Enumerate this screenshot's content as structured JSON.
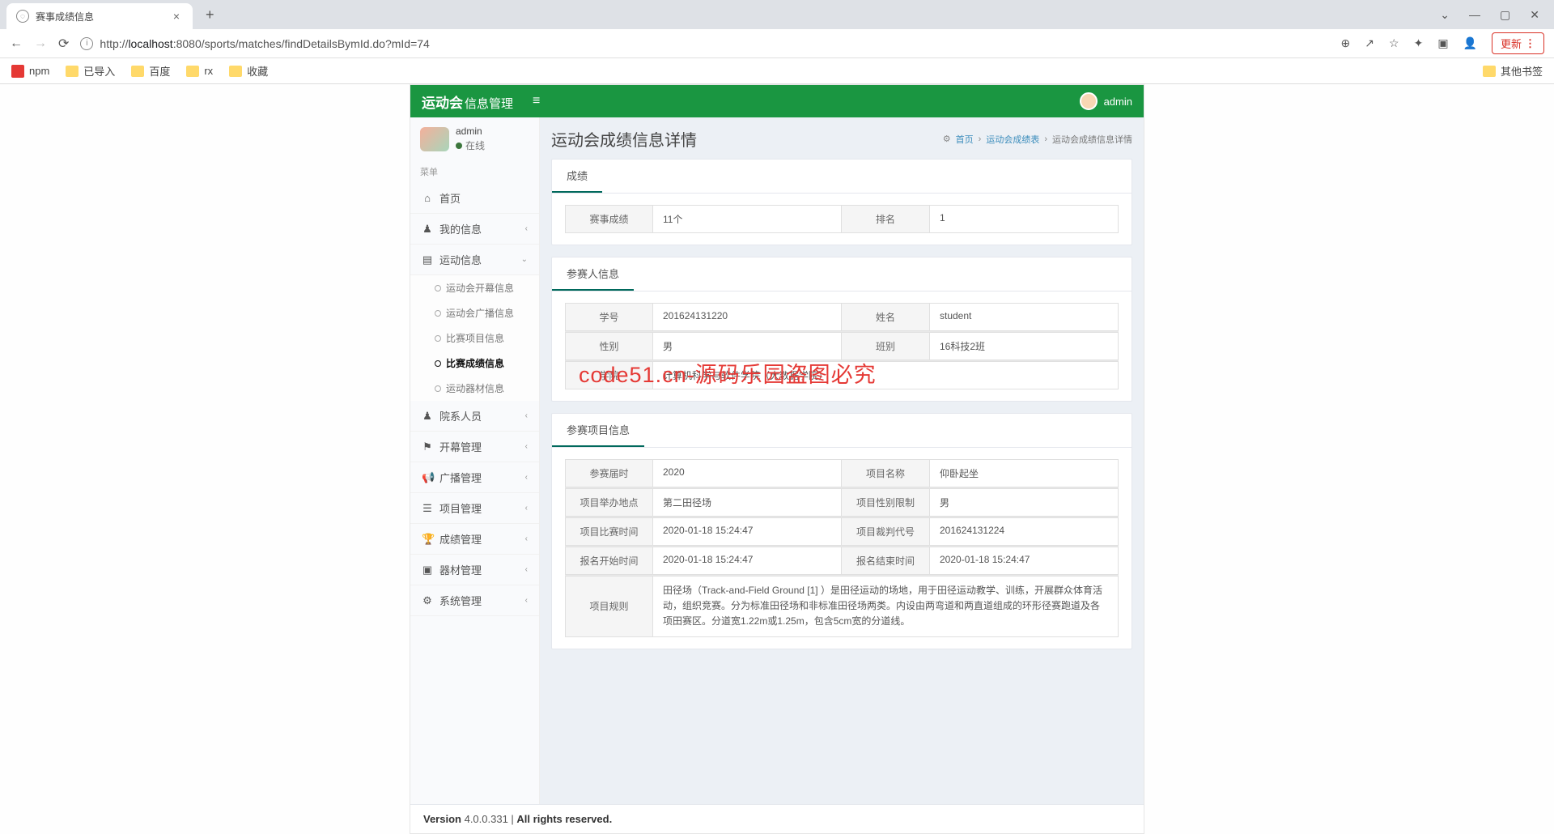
{
  "browser": {
    "tab_title": "赛事成绩信息",
    "url_prefix": "http://",
    "url_host": "localhost",
    "url_port": ":8080",
    "url_path": "/sports/matches/findDetailsBymId.do?mId=74",
    "update_label": "更新",
    "bookmarks": [
      "npm",
      "已导入",
      "百度",
      "rx",
      "收藏"
    ],
    "other_bookmarks": "其他书签"
  },
  "header": {
    "logo_bold": "运动会",
    "logo_light": "信息管理",
    "user": "admin"
  },
  "sidebar": {
    "user": {
      "name": "admin",
      "status": "在线"
    },
    "menu_header": "菜单",
    "items": {
      "home": "首页",
      "my_info": "我的信息",
      "sport_info": "运动信息",
      "staff": "院系人员",
      "opening": "开幕管理",
      "broadcast": "广播管理",
      "project": "项目管理",
      "score": "成绩管理",
      "equipment": "器材管理",
      "system": "系统管理"
    },
    "sub_sport": {
      "open": "运动会开幕信息",
      "broadcast": "运动会广播信息",
      "event": "比赛项目信息",
      "result": "比赛成绩信息",
      "equip": "运动器材信息"
    }
  },
  "content": {
    "page_title": "运动会成绩信息详情",
    "bc_home": "首页",
    "bc_list": "运动会成绩表",
    "bc_current": "运动会成绩信息详情"
  },
  "watermark": "code51.cn-源码乐园盗图必究",
  "panel_score": {
    "tab": "成绩",
    "result_label": "赛事成绩",
    "result_value": "11个",
    "rank_label": "排名",
    "rank_value": "1"
  },
  "panel_player": {
    "tab": "参赛人信息",
    "sid_label": "学号",
    "sid_value": "201624131220",
    "name_label": "姓名",
    "name_value": "student",
    "gender_label": "性别",
    "gender_value": "男",
    "class_label": "班别",
    "class_value": "16科技2班",
    "college_label": "学院",
    "college_value": "计算机科学与软件学院（大数据学院）"
  },
  "panel_event": {
    "tab": "参赛项目信息",
    "session_label": "参赛届时",
    "session_value": "2020",
    "ename_label": "项目名称",
    "ename_value": "仰卧起坐",
    "venue_label": "项目举办地点",
    "venue_value": "第二田径场",
    "gender_limit_label": "项目性别限制",
    "gender_limit_value": "男",
    "etime_label": "项目比赛时间",
    "etime_value": "2020-01-18 15:24:47",
    "judge_label": "项目裁判代号",
    "judge_value": "201624131224",
    "reg_start_label": "报名开始时间",
    "reg_start_value": "2020-01-18 15:24:47",
    "reg_end_label": "报名结束时间",
    "reg_end_value": "2020-01-18 15:24:47",
    "rules_label": "项目规则",
    "rules_value": "田径场（Track-and-Field Ground [1] ）是田径运动的场地，用于田径运动教学、训练，开展群众体育活动，组织竞赛。分为标准田径场和非标准田径场两类。内设由两弯道和两直道组成的环形径赛跑道及各项田赛区。分道宽1.22m或1.25m，包含5cm宽的分道线。"
  },
  "footer": {
    "version_label": "Version",
    "version_value": "4.0.0.331",
    "rights": "All rights reserved."
  }
}
